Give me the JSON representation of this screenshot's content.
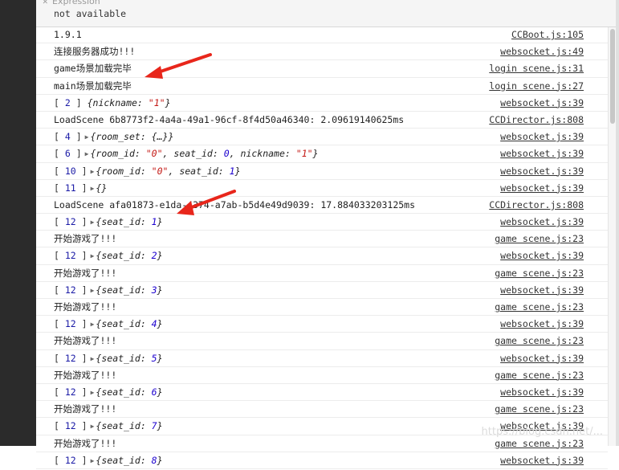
{
  "expression": {
    "label": "Expression",
    "value": "not available"
  },
  "rows": [
    {
      "kind": "text",
      "text": "1.9.1",
      "source": "CCBoot.js:105"
    },
    {
      "kind": "text",
      "text": "连接服务器成功!!!",
      "source": "websocket.js:49"
    },
    {
      "kind": "text",
      "text": "game场景加载完毕",
      "source": "login scene.js:31"
    },
    {
      "kind": "text",
      "text": "main场景加载完毕",
      "source": "login scene.js:27"
    },
    {
      "kind": "obj",
      "index": "2",
      "expanded": false,
      "obj": [
        {
          "k": "nickname",
          "v": "\"1\"",
          "t": "str"
        }
      ],
      "source": "websocket.js:39"
    },
    {
      "kind": "text",
      "text": "LoadScene 6b8773f2-4a4a-49a1-96cf-8f4d50a46340: 2.09619140625ms",
      "source": "CCDirector.js:808"
    },
    {
      "kind": "obj",
      "index": "4",
      "expanded": true,
      "obj": [
        {
          "k": "room_set",
          "v": "{…}",
          "t": "plain"
        }
      ],
      "source": "websocket.js:39"
    },
    {
      "kind": "obj",
      "index": "6",
      "expanded": true,
      "obj": [
        {
          "k": "room_id",
          "v": "\"0\"",
          "t": "str"
        },
        {
          "k": "seat_id",
          "v": "0",
          "t": "num"
        },
        {
          "k": "nickname",
          "v": "\"1\"",
          "t": "str"
        }
      ],
      "source": "websocket.js:39"
    },
    {
      "kind": "obj",
      "index": "10",
      "expanded": true,
      "obj": [
        {
          "k": "room_id",
          "v": "\"0\"",
          "t": "str"
        },
        {
          "k": "seat_id",
          "v": "1",
          "t": "num"
        }
      ],
      "source": "websocket.js:39"
    },
    {
      "kind": "obj",
      "index": "11",
      "expanded": true,
      "obj": [],
      "source": "websocket.js:39"
    },
    {
      "kind": "text",
      "text": "LoadScene afa01873-e1da-4374-a7ab-b5d4e49d9039: 17.884033203125ms",
      "source": "CCDirector.js:808"
    },
    {
      "kind": "obj",
      "index": "12",
      "expanded": true,
      "obj": [
        {
          "k": "seat_id",
          "v": "1",
          "t": "num"
        }
      ],
      "source": "websocket.js:39"
    },
    {
      "kind": "text",
      "text": "开始游戏了!!!",
      "source": "game scene.js:23"
    },
    {
      "kind": "obj",
      "index": "12",
      "expanded": true,
      "obj": [
        {
          "k": "seat_id",
          "v": "2",
          "t": "num"
        }
      ],
      "source": "websocket.js:39"
    },
    {
      "kind": "text",
      "text": "开始游戏了!!!",
      "source": "game scene.js:23"
    },
    {
      "kind": "obj",
      "index": "12",
      "expanded": true,
      "obj": [
        {
          "k": "seat_id",
          "v": "3",
          "t": "num"
        }
      ],
      "source": "websocket.js:39"
    },
    {
      "kind": "text",
      "text": "开始游戏了!!!",
      "source": "game scene.js:23"
    },
    {
      "kind": "obj",
      "index": "12",
      "expanded": true,
      "obj": [
        {
          "k": "seat_id",
          "v": "4",
          "t": "num"
        }
      ],
      "source": "websocket.js:39"
    },
    {
      "kind": "text",
      "text": "开始游戏了!!!",
      "source": "game scene.js:23"
    },
    {
      "kind": "obj",
      "index": "12",
      "expanded": true,
      "obj": [
        {
          "k": "seat_id",
          "v": "5",
          "t": "num"
        }
      ],
      "source": "websocket.js:39"
    },
    {
      "kind": "text",
      "text": "开始游戏了!!!",
      "source": "game scene.js:23"
    },
    {
      "kind": "obj",
      "index": "12",
      "expanded": true,
      "obj": [
        {
          "k": "seat_id",
          "v": "6",
          "t": "num"
        }
      ],
      "source": "websocket.js:39"
    },
    {
      "kind": "text",
      "text": "开始游戏了!!!",
      "source": "game scene.js:23"
    },
    {
      "kind": "obj",
      "index": "12",
      "expanded": true,
      "obj": [
        {
          "k": "seat_id",
          "v": "7",
          "t": "num"
        }
      ],
      "source": "websocket.js:39"
    },
    {
      "kind": "text",
      "text": "开始游戏了!!!",
      "source": "game scene.js:23"
    },
    {
      "kind": "obj",
      "index": "12",
      "expanded": true,
      "obj": [
        {
          "k": "seat_id",
          "v": "8",
          "t": "num"
        }
      ],
      "source": "websocket.js:39"
    }
  ],
  "watermark": "https://blog.csdn.net/..."
}
